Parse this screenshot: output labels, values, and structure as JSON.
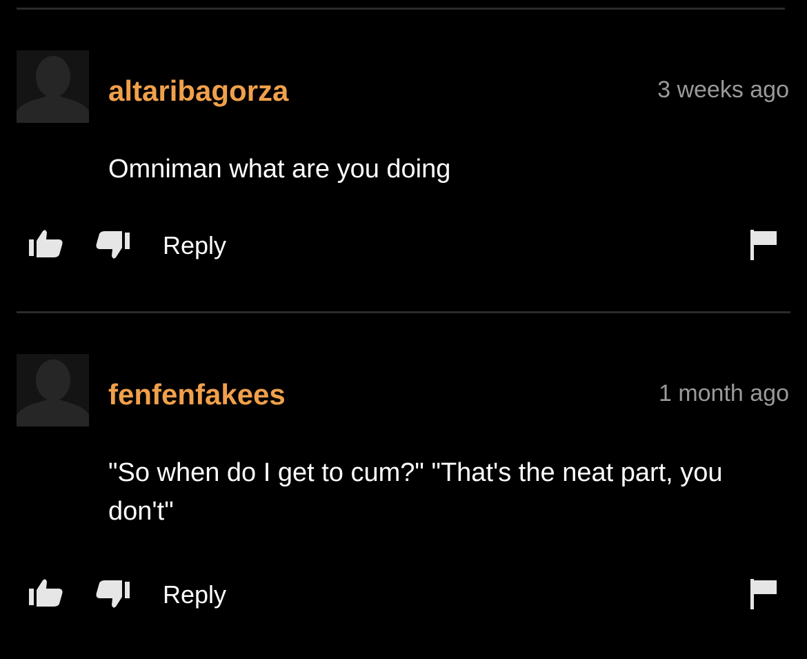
{
  "colors": {
    "background": "#000000",
    "username": "#f0a04b",
    "timestamp": "#9a9a9a",
    "text": "#ffffff",
    "icon": "#e6e6e6",
    "divider": "#2b2b2b"
  },
  "comments": [
    {
      "username": "altaribagorza",
      "time": "3 weeks ago",
      "text": "Omniman what are you doing",
      "reply_label": "Reply",
      "icons": [
        "thumbs-up-icon",
        "thumbs-down-icon",
        "flag-icon"
      ]
    },
    {
      "username": "fenfenfakees",
      "time": "1 month ago",
      "text": "\"So when do I get to cum?\" \"That's the neat part, you don't\"",
      "reply_label": "Reply",
      "icons": [
        "thumbs-up-icon",
        "thumbs-down-icon",
        "flag-icon"
      ]
    }
  ]
}
